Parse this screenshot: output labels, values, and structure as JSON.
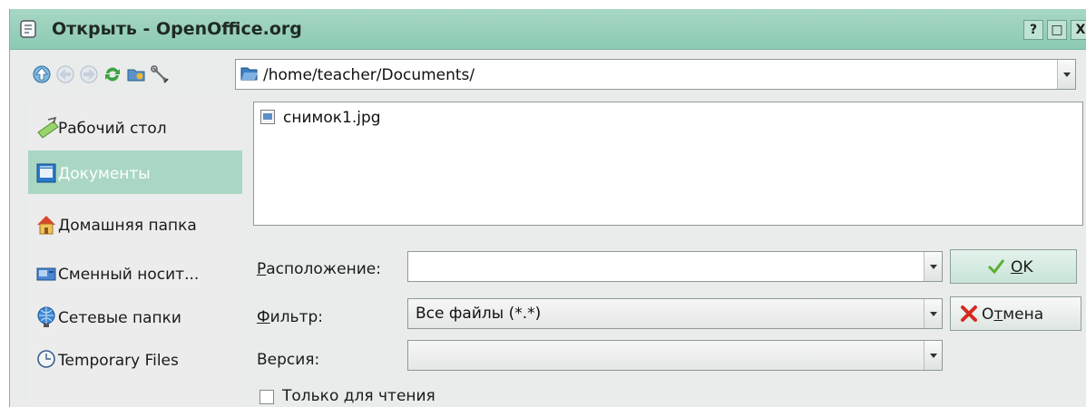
{
  "window": {
    "title": "Открыть - OpenOffice.org"
  },
  "titlebar_buttons": {
    "help": "?",
    "maximize": "□",
    "close": "X"
  },
  "path": {
    "value": "/home/teacher/Documents/"
  },
  "sidebar": {
    "items": [
      {
        "label": "Рабочий стол",
        "icon": "desktop-icon",
        "selected": false
      },
      {
        "label": "Документы",
        "icon": "documents-icon",
        "selected": true
      },
      {
        "label": "Домашняя папка",
        "icon": "home-icon",
        "selected": false
      },
      {
        "label": "Сменный носит...",
        "icon": "removable-media-icon",
        "selected": false
      },
      {
        "label": "Сетевые папки",
        "icon": "network-folders-icon",
        "selected": false
      },
      {
        "label": "Temporary Files",
        "icon": "clock-icon",
        "selected": false
      }
    ]
  },
  "files": [
    {
      "name": "снимок1.jpg",
      "icon": "image-file-icon"
    }
  ],
  "location": {
    "label_mnemonic": "Р",
    "label_rest": "асположение:",
    "value": ""
  },
  "filter": {
    "label_mnemonic": "Ф",
    "label_rest": "ильтр:",
    "value": "Все файлы (*.*)"
  },
  "version": {
    "label": "Версия:",
    "value": ""
  },
  "buttons": {
    "ok": {
      "mnemonic": "O",
      "rest": "K"
    },
    "cancel": {
      "pre": "О",
      "mnemonic": "т",
      "rest": "мена"
    }
  },
  "readonly": {
    "label": "Только для чтения",
    "checked": false
  },
  "colors": {
    "titlebar": "#8ccab2",
    "selection": "#aad7c3",
    "window_bg": "#e9ecea"
  }
}
